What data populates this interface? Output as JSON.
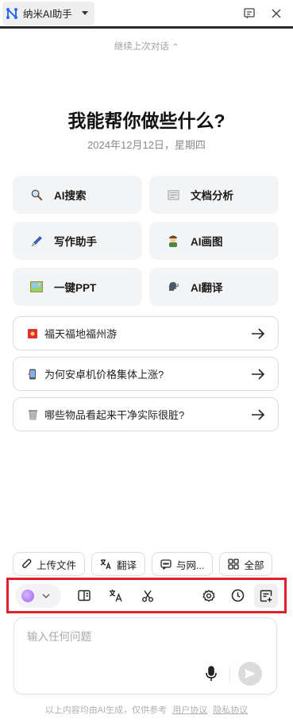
{
  "titlebar": {
    "app_name": "纳米AI助手",
    "logo_icon": "nami-logo-icon",
    "icons": [
      "note-icon",
      "close-icon"
    ]
  },
  "continue_label": "继续上次对话",
  "hero": {
    "title": "我能帮你做些什么?",
    "date": "2024年12月12日，星期四"
  },
  "features": [
    {
      "label": "AI搜索",
      "icon": "magnifier-icon"
    },
    {
      "label": "文档分析",
      "icon": "document-icon"
    },
    {
      "label": "写作助手",
      "icon": "pen-icon"
    },
    {
      "label": "AI画图",
      "icon": "artist-icon"
    },
    {
      "label": "一键PPT",
      "icon": "picture-icon"
    },
    {
      "label": "AI翻译",
      "icon": "speaking-head-icon"
    }
  ],
  "suggestions": [
    {
      "text": "福天福地福州游",
      "icon": "fu-icon"
    },
    {
      "text": "为何安卓机价格集体上涨?",
      "icon": "phone-icon"
    },
    {
      "text": "哪些物品看起来干净实际很脏?",
      "icon": "trash-icon"
    }
  ],
  "chips": [
    {
      "label": "上传文件",
      "icon": "paperclip-icon"
    },
    {
      "label": "翻译",
      "icon": "translate-icon"
    },
    {
      "label": "与网...",
      "icon": "chat-icon"
    },
    {
      "label": "全部",
      "icon": "grid-icon"
    }
  ],
  "input": {
    "placeholder": "输入任何问题"
  },
  "footer": {
    "text": "以上内容均由AI生成，仅供参考",
    "link_terms": "用户协议",
    "link_privacy": "隐私协议"
  },
  "colors": {
    "highlight_border": "#e0202a",
    "model_dot": "#9a63f2"
  }
}
